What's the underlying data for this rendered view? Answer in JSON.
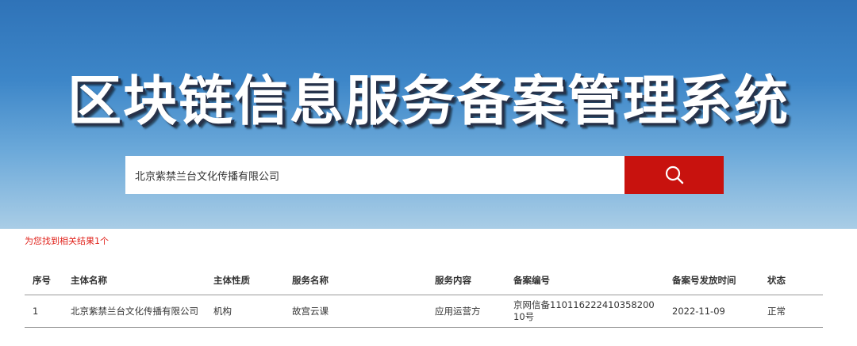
{
  "header": {
    "title": "区块链信息服务备案管理系统"
  },
  "search": {
    "value": "北京紫禁兰台文化传播有限公司",
    "button_icon": "search-icon"
  },
  "result_count": "为您找到相关结果1个",
  "table": {
    "columns": [
      "序号",
      "主体名称",
      "主体性质",
      "服务名称",
      "服务内容",
      "备案编号",
      "备案号发放时间",
      "状态"
    ],
    "rows": [
      [
        "1",
        "北京紫禁兰台文化传播有限公司",
        "机构",
        "故宫云课",
        "应用运营方",
        "京网信备11011622241035820010号",
        "2022-11-09",
        "正常"
      ]
    ]
  },
  "colors": {
    "search_button": "#c8120e",
    "result_count": "#e0221b"
  }
}
